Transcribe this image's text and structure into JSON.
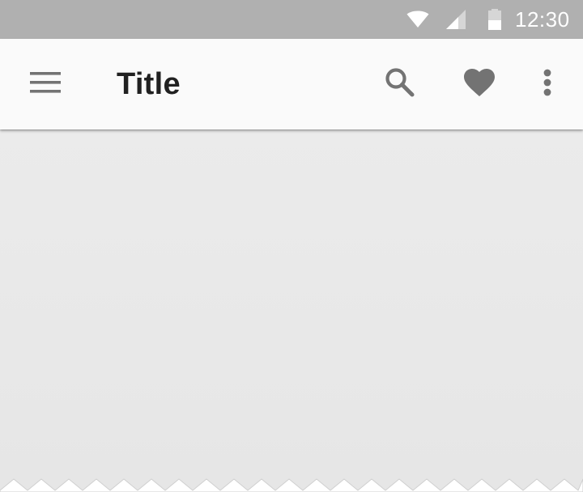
{
  "status_bar": {
    "time": "12:30",
    "icons": {
      "wifi": "wifi-icon",
      "signal": "cell-signal-icon",
      "battery": "battery-icon"
    },
    "background": "#b0b0b0",
    "foreground": "#ffffff"
  },
  "app_bar": {
    "title": "Title",
    "navigation_icon": "menu-icon",
    "actions": [
      {
        "name": "search",
        "icon": "search-icon"
      },
      {
        "name": "favorite",
        "icon": "heart-icon"
      },
      {
        "name": "more",
        "icon": "more-vert-icon"
      }
    ],
    "background": "#fafafa",
    "icon_color": "#737373",
    "title_color": "#212121"
  },
  "content": {
    "background": "#e8e8e8"
  }
}
